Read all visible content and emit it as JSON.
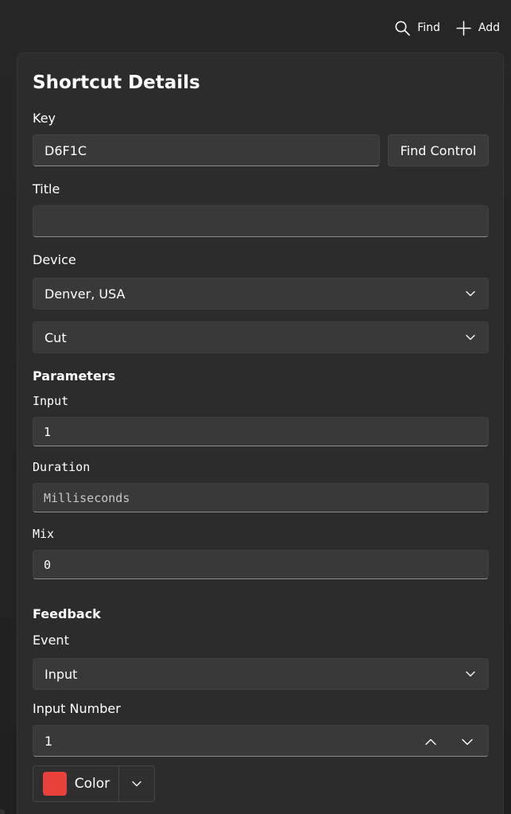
{
  "toolbar": {
    "find_label": "Find",
    "add_label": "Add",
    "find_icon": "search-icon",
    "add_icon": "plus-icon"
  },
  "panel": {
    "title": "Shortcut Details",
    "key": {
      "label": "Key",
      "value": "D6F1C",
      "find_control_label": "Find Control"
    },
    "title_field": {
      "label": "Title",
      "value": ""
    },
    "device": {
      "label": "Device",
      "selected": "Denver, USA",
      "function_selected": "Cut"
    },
    "parameters": {
      "heading": "Parameters",
      "input": {
        "label": "Input",
        "value": "1"
      },
      "duration": {
        "label": "Duration",
        "placeholder": "Milliseconds"
      },
      "mix": {
        "label": "Mix",
        "value": "0"
      }
    },
    "feedback": {
      "heading": "Feedback",
      "event": {
        "label": "Event",
        "selected": "Input"
      },
      "input_number": {
        "label": "Input Number",
        "value": "1"
      },
      "color": {
        "label": "Color",
        "swatch": "#e8413c"
      }
    }
  },
  "colors": {
    "background": "#232323",
    "panel": "#2c2c2c",
    "control": "#393939",
    "swatch_red": "#e8413c"
  }
}
